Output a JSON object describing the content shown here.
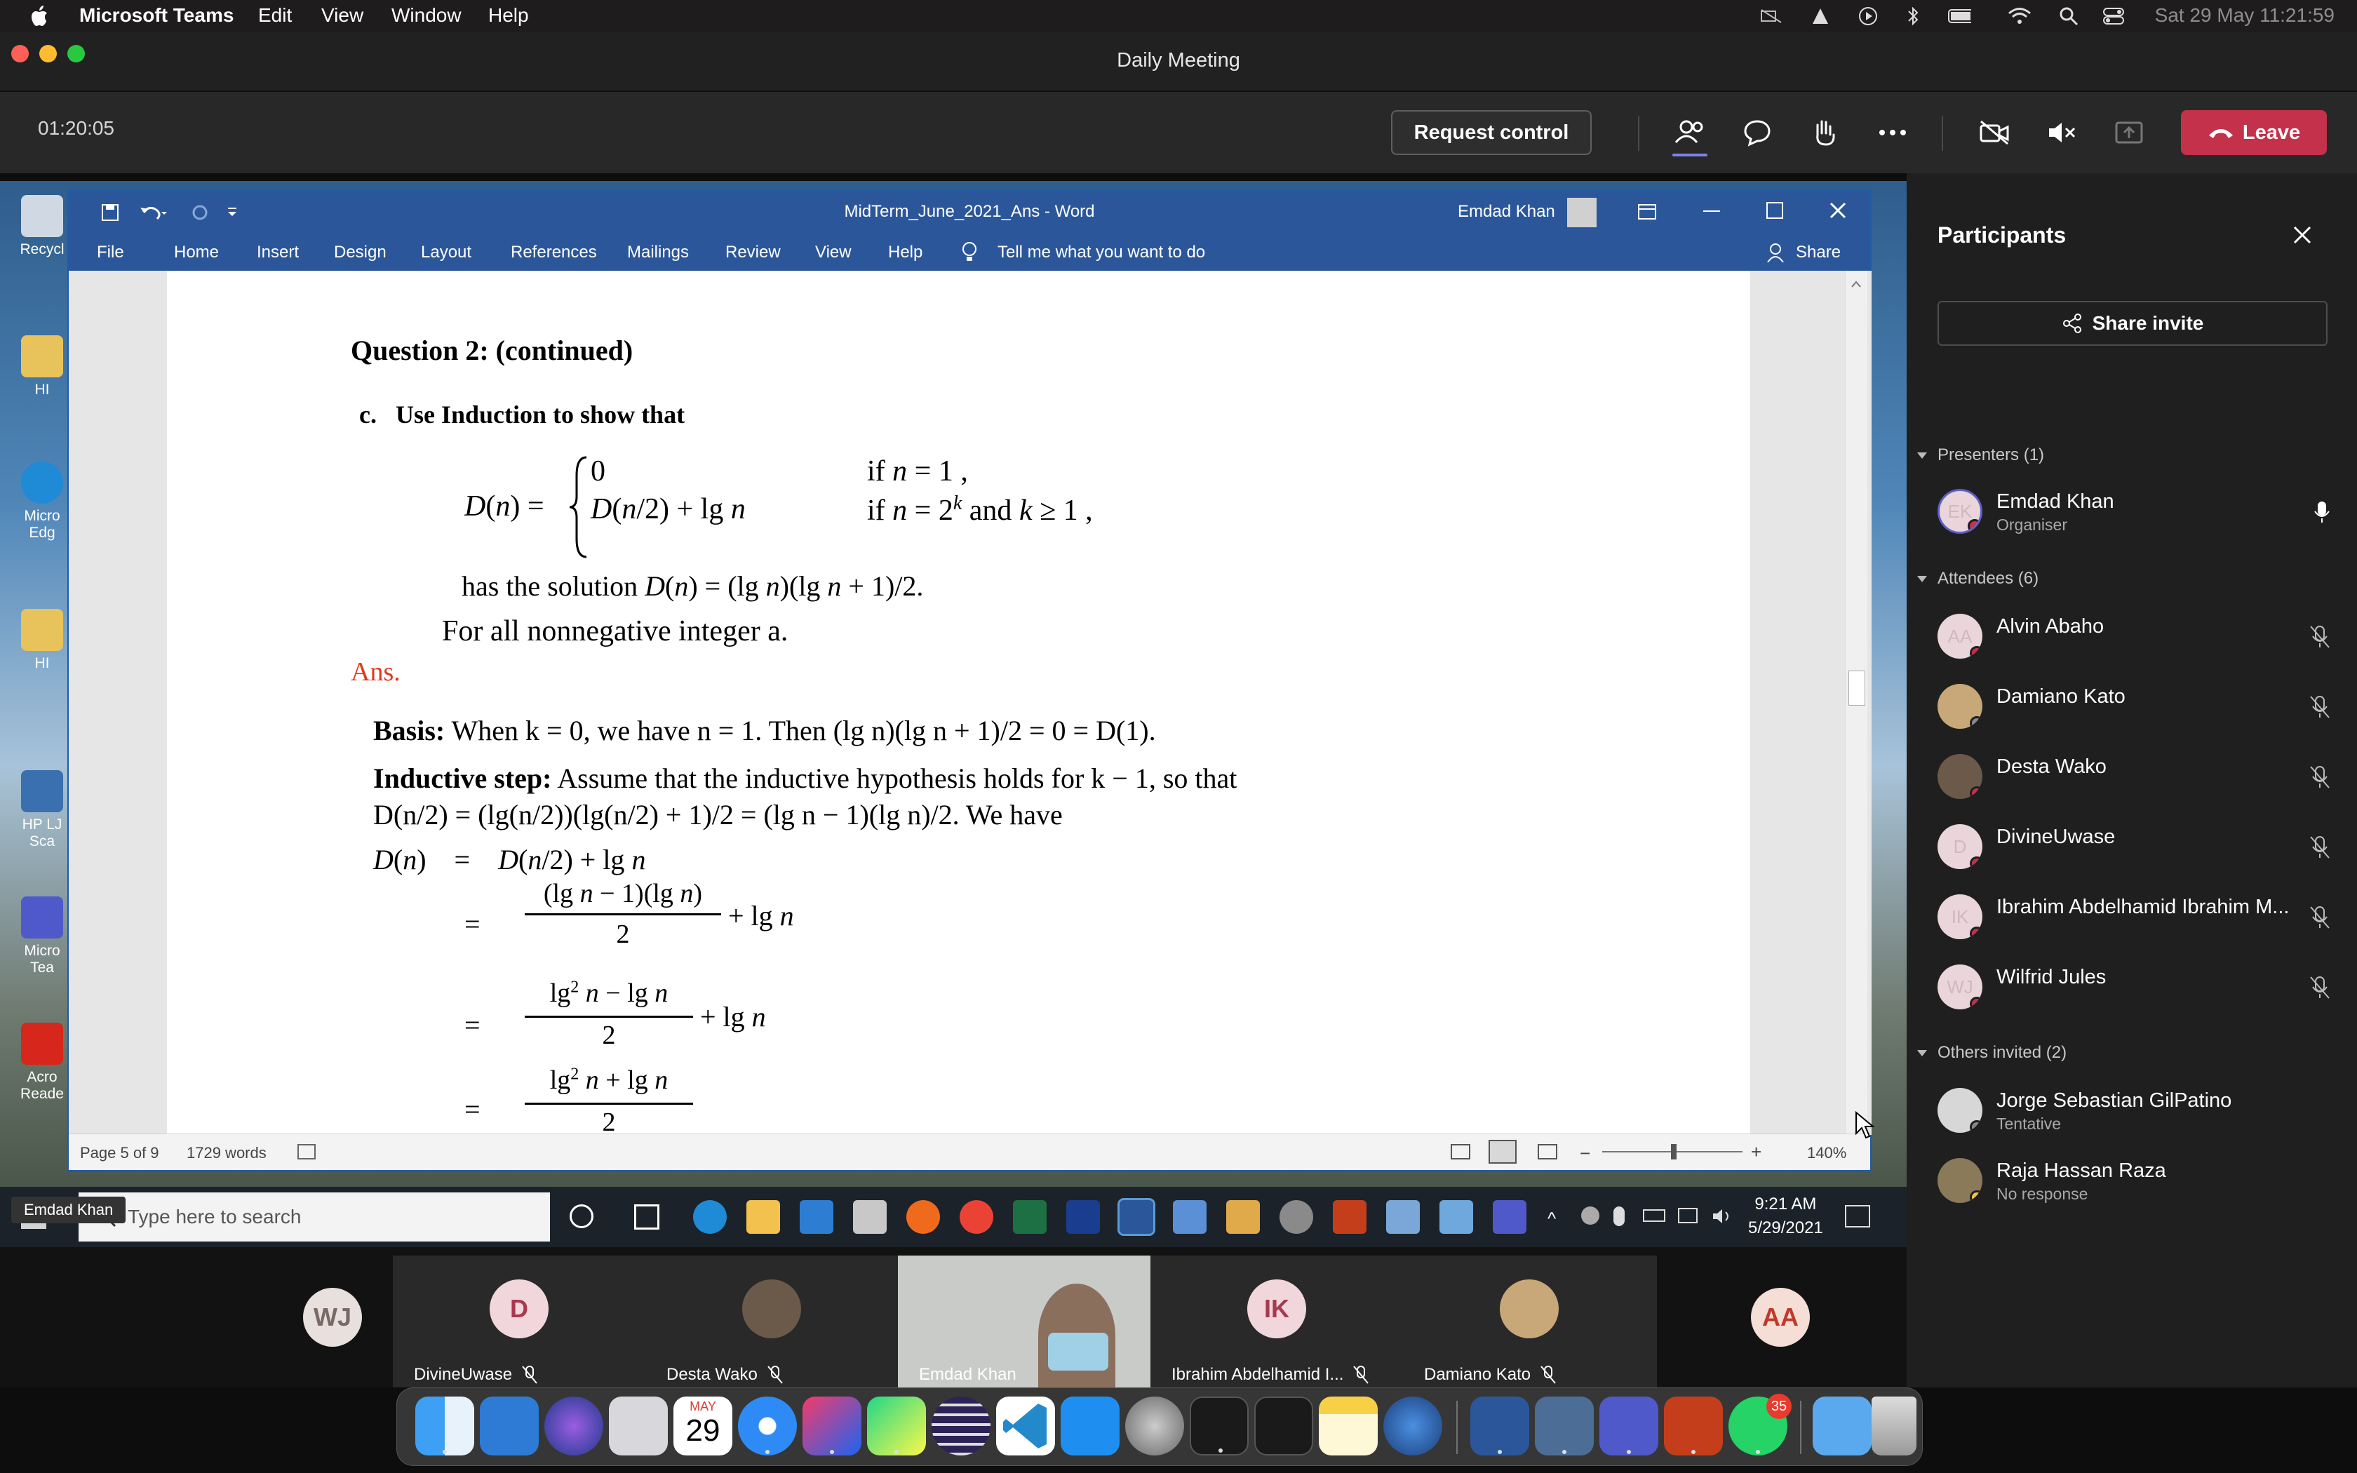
{
  "menubar": {
    "app": "Microsoft Teams",
    "menus": [
      "Edit",
      "View",
      "Window",
      "Help"
    ],
    "clock": "Sat 29 May  11:21:59"
  },
  "window": {
    "title": "Daily Meeting"
  },
  "callbar": {
    "timer": "01:20:05",
    "request_control": "Request control",
    "leave": "Leave"
  },
  "word": {
    "title": "MidTerm_June_2021_Ans  -  Word",
    "user": "Emdad Khan",
    "tabs": [
      "File",
      "Home",
      "Insert",
      "Design",
      "Layout",
      "References",
      "Mailings",
      "Review",
      "View",
      "Help"
    ],
    "tell_me": "Tell me what you want to do",
    "share": "Share",
    "status_page": "Page 5 of 9",
    "status_words": "1729 words",
    "zoom": "140%"
  },
  "doc": {
    "heading": "Question 2: (continued)",
    "part_label": "c.",
    "part_text": "Use Induction to show that",
    "has_solution": "has the solution",
    "nonneg": "For all nonnegative integer a.",
    "ans": "Ans.",
    "basis_label": "Basis:",
    "basis_text": "When k = 0, we have n = 1. Then (lg n)(lg n + 1)/2 = 0 = D(1).",
    "ind_label": "Inductive step:",
    "ind_text": "Assume that the inductive hypothesis holds for k − 1, so that",
    "ind_text2": "D(n/2) = (lg(n/2))(lg(n/2) + 1)/2 = (lg n − 1)(lg n)/2. We have"
  },
  "taskbar": {
    "search_placeholder": "Type here to search",
    "time": "9:21 AM",
    "date": "5/29/2021",
    "presenter_chip": "Emdad Khan"
  },
  "desktop_icons": [
    "Recycl",
    "HI",
    "Micro Edg",
    "HI",
    "HP LJ Sca",
    "Micro Tea",
    "Acro Reade"
  ],
  "participants": {
    "title": "Participants",
    "share_invite": "Share invite",
    "presenters_label": "Presenters (1)",
    "presenters": [
      {
        "initials": "EK",
        "name": "Emdad Khan",
        "sub": "Organiser"
      }
    ],
    "attendees_label": "Attendees (6)",
    "attendees": [
      {
        "initials": "AA",
        "name": "Alvin Abaho"
      },
      {
        "initials": "",
        "name": "Damiano Kato"
      },
      {
        "initials": "",
        "name": "Desta Wako"
      },
      {
        "initials": "D",
        "name": "DivineUwase"
      },
      {
        "initials": "IK",
        "name": "Ibrahim Abdelhamid Ibrahim M..."
      },
      {
        "initials": "WJ",
        "name": "Wilfrid Jules"
      }
    ],
    "others_label": "Others invited (2)",
    "others": [
      {
        "name": "Jorge Sebastian GilPatino",
        "sub": "Tentative"
      },
      {
        "name": "Raja Hassan Raza",
        "sub": "No response"
      }
    ]
  },
  "gallery": [
    {
      "initials": "WJ",
      "name": ""
    },
    {
      "initials": "D",
      "name": "DivineUwase"
    },
    {
      "initials": "",
      "name": "Desta Wako"
    },
    {
      "initials": "",
      "name": "Emdad Khan"
    },
    {
      "initials": "IK",
      "name": "Ibrahim Abdelhamid I..."
    },
    {
      "initials": "",
      "name": "Damiano Kato"
    },
    {
      "initials": "AA",
      "name": ""
    }
  ],
  "dock": {
    "calendar_month": "MAY",
    "calendar_day": "29",
    "whatsapp_badge": "35"
  }
}
